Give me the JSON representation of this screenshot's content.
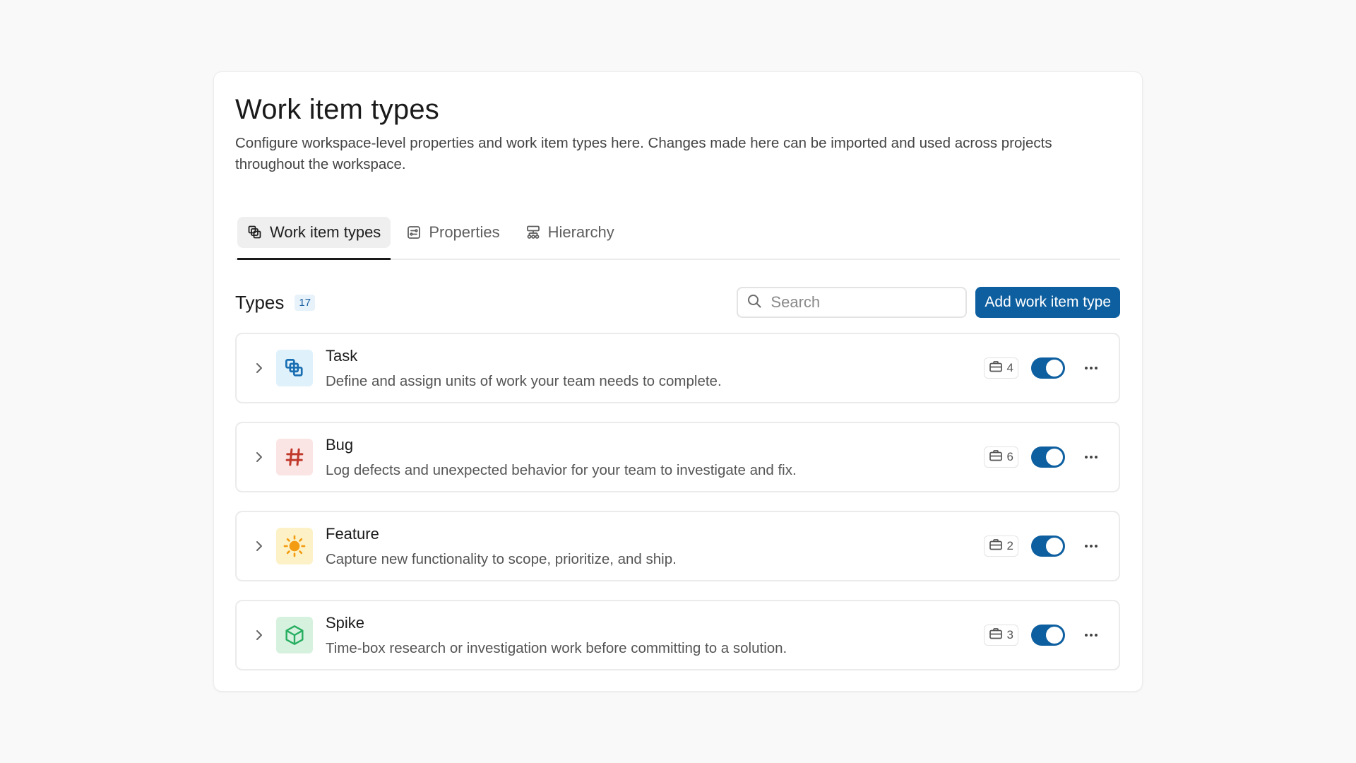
{
  "page": {
    "title": "Work item types",
    "description": "Configure workspace-level properties and work item types here. Changes made here can be imported and used across projects throughout the workspace."
  },
  "tabs": [
    {
      "label": "Work item types",
      "icon": "layers-icon",
      "active": true
    },
    {
      "label": "Properties",
      "icon": "properties-icon",
      "active": false
    },
    {
      "label": "Hierarchy",
      "icon": "hierarchy-icon",
      "active": false
    }
  ],
  "types_section": {
    "title": "Types",
    "count": "17",
    "search_placeholder": "Search",
    "add_button_label": "Add work item type"
  },
  "work_item_types": [
    {
      "name": "Task",
      "description": "Define and assign units of work your team needs to complete.",
      "project_count": "4",
      "enabled": true,
      "icon": "task-icon",
      "icon_bg": "#dff1fb",
      "icon_color": "#1a6fb3"
    },
    {
      "name": "Bug",
      "description": "Log defects and unexpected behavior for your team to investigate and fix.",
      "project_count": "6",
      "enabled": true,
      "icon": "hash-icon",
      "icon_bg": "#fbe4e4",
      "icon_color": "#c0392b"
    },
    {
      "name": "Feature",
      "description": "Capture new functionality to scope, prioritize, and ship.",
      "project_count": "2",
      "enabled": true,
      "icon": "sun-icon",
      "icon_bg": "#fdf2c7",
      "icon_color": "#f39c12"
    },
    {
      "name": "Spike",
      "description": "Time-box research or investigation work before committing to a solution.",
      "project_count": "3",
      "enabled": true,
      "icon": "cube-icon",
      "icon_bg": "#d6f2df",
      "icon_color": "#27ae60"
    }
  ],
  "colors": {
    "accent": "#0d5fa0",
    "badge_bg": "#e8f2fb",
    "badge_text": "#1a5fa0"
  }
}
